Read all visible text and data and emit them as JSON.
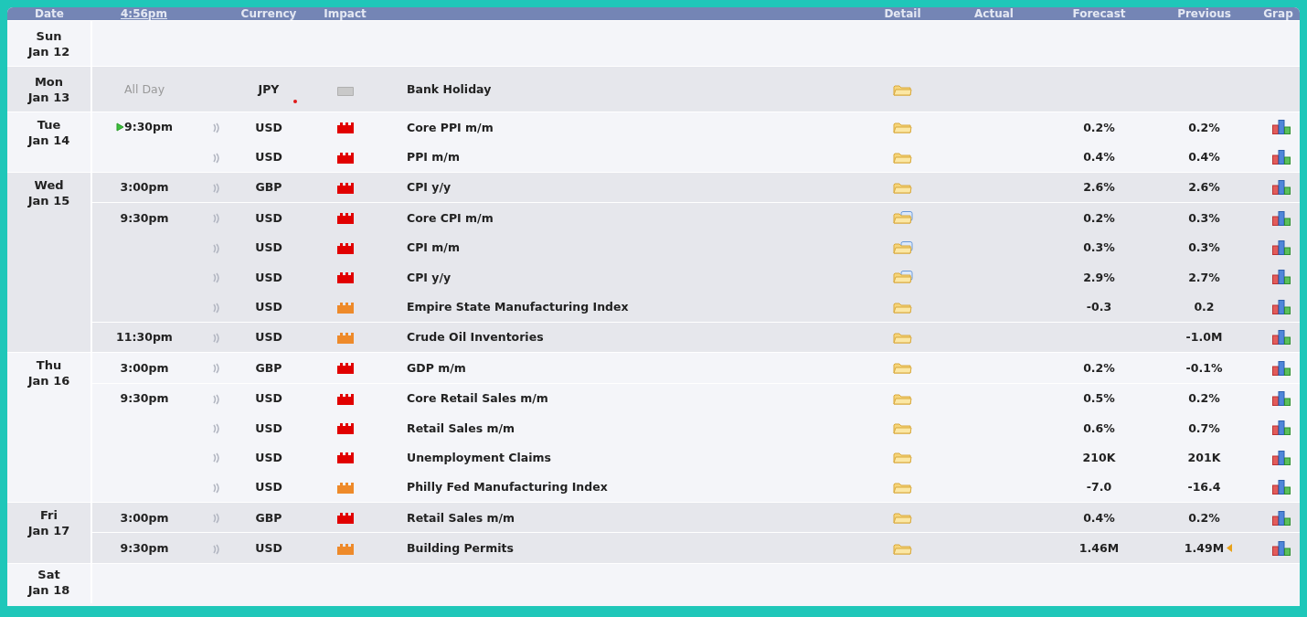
{
  "columns": [
    {
      "label": "Date",
      "kind": "text"
    },
    {
      "label": "4:56pm",
      "kind": "link"
    },
    {
      "kind": "blank"
    },
    {
      "label": "Currency",
      "kind": "text"
    },
    {
      "label": "Impact",
      "kind": "text"
    },
    {
      "kind": "blank"
    },
    {
      "label": "Detail",
      "kind": "text"
    },
    {
      "label": "Actual",
      "kind": "text"
    },
    {
      "label": "Forecast",
      "kind": "text"
    },
    {
      "label": "Previous",
      "kind": "text"
    },
    {
      "label": "Grap",
      "kind": "text"
    }
  ],
  "days": [
    {
      "day": "Sun",
      "date": "Jan 12"
    },
    {
      "day": "Mon",
      "date": "Jan 13",
      "events": [
        {
          "time": "All Day",
          "all_day": true,
          "upcoming": false,
          "sound": false,
          "currency": "JPY",
          "marked": true,
          "impact": {
            "kind": "holiday"
          },
          "title": "Bank Holiday",
          "detail": {
            "kind": "folder"
          },
          "graph": false,
          "revised": false
        }
      ]
    },
    {
      "day": "Tue",
      "date": "Jan 14",
      "events": [
        {
          "time": "9:30pm",
          "all_day": false,
          "upcoming": true,
          "sound": true,
          "currency": "USD",
          "marked": false,
          "impact": {
            "kind": "high"
          },
          "title": "Core PPI m/m",
          "detail": {
            "kind": "folder"
          },
          "forecast": "0.2%",
          "previous": "0.2%",
          "graph": true,
          "revised": false
        },
        {
          "upcoming": false,
          "sound": true,
          "currency": "USD",
          "marked": false,
          "impact": {
            "kind": "high"
          },
          "title": "PPI m/m",
          "detail": {
            "kind": "folder"
          },
          "forecast": "0.4%",
          "previous": "0.4%",
          "graph": true,
          "revised": false
        }
      ]
    },
    {
      "day": "Wed",
      "date": "Jan 15",
      "events": [
        {
          "time": "3:00pm",
          "all_day": false,
          "upcoming": false,
          "sound": true,
          "currency": "GBP",
          "marked": false,
          "impact": {
            "kind": "high"
          },
          "title": "CPI y/y",
          "detail": {
            "kind": "folder"
          },
          "forecast": "2.6%",
          "previous": "2.6%",
          "graph": true,
          "revised": false
        },
        {
          "time": "9:30pm",
          "all_day": false,
          "upcoming": false,
          "sound": true,
          "currency": "USD",
          "marked": false,
          "impact": {
            "kind": "high"
          },
          "title": "Core CPI m/m",
          "detail": {
            "kind": "folder-doc"
          },
          "forecast": "0.2%",
          "previous": "0.3%",
          "graph": true,
          "revised": false
        },
        {
          "upcoming": false,
          "sound": true,
          "currency": "USD",
          "marked": false,
          "impact": {
            "kind": "high"
          },
          "title": "CPI m/m",
          "detail": {
            "kind": "folder-doc"
          },
          "forecast": "0.3%",
          "previous": "0.3%",
          "graph": true,
          "revised": false
        },
        {
          "upcoming": false,
          "sound": true,
          "currency": "USD",
          "marked": false,
          "impact": {
            "kind": "high"
          },
          "title": "CPI y/y",
          "detail": {
            "kind": "folder-doc"
          },
          "forecast": "2.9%",
          "previous": "2.7%",
          "graph": true,
          "revised": false
        },
        {
          "upcoming": false,
          "sound": true,
          "currency": "USD",
          "marked": false,
          "impact": {
            "kind": "medium"
          },
          "title": "Empire State Manufacturing Index",
          "detail": {
            "kind": "folder"
          },
          "forecast": "-0.3",
          "previous": "0.2",
          "graph": true,
          "revised": false
        },
        {
          "time": "11:30pm",
          "all_day": false,
          "upcoming": false,
          "sound": true,
          "currency": "USD",
          "marked": false,
          "impact": {
            "kind": "medium"
          },
          "title": "Crude Oil Inventories",
          "detail": {
            "kind": "folder"
          },
          "previous": "-1.0M",
          "graph": true,
          "revised": false
        }
      ]
    },
    {
      "day": "Thu",
      "date": "Jan 16",
      "events": [
        {
          "time": "3:00pm",
          "all_day": false,
          "upcoming": false,
          "sound": true,
          "currency": "GBP",
          "marked": false,
          "impact": {
            "kind": "high"
          },
          "title": "GDP m/m",
          "detail": {
            "kind": "folder"
          },
          "forecast": "0.2%",
          "previous": "-0.1%",
          "graph": true,
          "revised": false
        },
        {
          "time": "9:30pm",
          "all_day": false,
          "upcoming": false,
          "sound": true,
          "currency": "USD",
          "marked": false,
          "impact": {
            "kind": "high"
          },
          "title": "Core Retail Sales m/m",
          "detail": {
            "kind": "folder"
          },
          "forecast": "0.5%",
          "previous": "0.2%",
          "graph": true,
          "revised": false
        },
        {
          "upcoming": false,
          "sound": true,
          "currency": "USD",
          "marked": false,
          "impact": {
            "kind": "high"
          },
          "title": "Retail Sales m/m",
          "detail": {
            "kind": "folder"
          },
          "forecast": "0.6%",
          "previous": "0.7%",
          "graph": true,
          "revised": false
        },
        {
          "upcoming": false,
          "sound": true,
          "currency": "USD",
          "marked": false,
          "impact": {
            "kind": "high"
          },
          "title": "Unemployment Claims",
          "detail": {
            "kind": "folder"
          },
          "forecast": "210K",
          "previous": "201K",
          "graph": true,
          "revised": false
        },
        {
          "upcoming": false,
          "sound": true,
          "currency": "USD",
          "marked": false,
          "impact": {
            "kind": "medium"
          },
          "title": "Philly Fed Manufacturing Index",
          "detail": {
            "kind": "folder"
          },
          "forecast": "-7.0",
          "previous": "-16.4",
          "graph": true,
          "revised": false
        }
      ]
    },
    {
      "day": "Fri",
      "date": "Jan 17",
      "events": [
        {
          "time": "3:00pm",
          "all_day": false,
          "upcoming": false,
          "sound": true,
          "currency": "GBP",
          "marked": false,
          "impact": {
            "kind": "high"
          },
          "title": "Retail Sales m/m",
          "detail": {
            "kind": "folder"
          },
          "forecast": "0.4%",
          "previous": "0.2%",
          "graph": true,
          "revised": false
        },
        {
          "time": "9:30pm",
          "all_day": false,
          "upcoming": false,
          "sound": true,
          "currency": "USD",
          "marked": false,
          "impact": {
            "kind": "medium"
          },
          "title": "Building Permits",
          "detail": {
            "kind": "folder"
          },
          "forecast": "1.46M",
          "previous": "1.49M",
          "graph": true,
          "revised": true
        }
      ]
    },
    {
      "day": "Sat",
      "date": "Jan 18"
    }
  ]
}
